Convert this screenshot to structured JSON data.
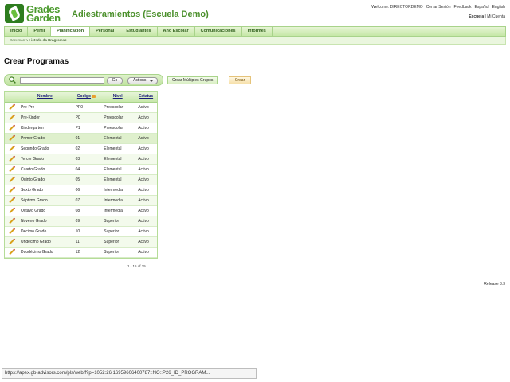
{
  "header": {
    "logo_line1": "Grades",
    "logo_line2": "Garden",
    "app_title": "Adiestramientos (Escuela Demo)",
    "top_links": [
      "Welcome: DIRECTORDEMO",
      "Cerrar Sesión",
      "Feedback",
      "Español",
      "English"
    ],
    "scope_active": "Escuela",
    "scope_sep": " | ",
    "scope_other": "Mi Cuenta"
  },
  "nav": {
    "tabs": [
      "Inicio",
      "Perfil",
      "Planificación",
      "Personal",
      "Estudiantes",
      "Año Escolar",
      "Comunicaciones",
      "Informes"
    ],
    "active_index": 2
  },
  "breadcrumb": {
    "parent": "Resumen",
    "sep": " > ",
    "current": "Listado de Programas"
  },
  "page_title": "Crear Programas",
  "search": {
    "value": "",
    "go_label": "Go",
    "actions_label": "Actions"
  },
  "buttons": {
    "create_multiple": "Crear Múltiples Grupos",
    "create": "Crear"
  },
  "table": {
    "columns": [
      "Nombre",
      "Codigo",
      "Nivel",
      "Estatus"
    ],
    "rows": [
      [
        "Pre-Pre",
        "PP0",
        "Preescolar",
        "Activo"
      ],
      [
        "Pre-Kinder",
        "P0",
        "Preescolar",
        "Activo"
      ],
      [
        "Kindergarten",
        "P1",
        "Preescolar",
        "Activo"
      ],
      [
        "Primer Grado",
        "01",
        "Elemental",
        "Activo"
      ],
      [
        "Segundo Grado",
        "02",
        "Elemental",
        "Activo"
      ],
      [
        "Tercer Grado",
        "03",
        "Elemental",
        "Activo"
      ],
      [
        "Cuarto Grado",
        "04",
        "Elemental",
        "Activo"
      ],
      [
        "Quinto Grado",
        "05",
        "Elemental",
        "Activo"
      ],
      [
        "Sexto Grado",
        "06",
        "Intermedia",
        "Activo"
      ],
      [
        "Séptimo Grado",
        "07",
        "Intermedia",
        "Activo"
      ],
      [
        "Octavo Grado",
        "08",
        "Intermedia",
        "Activo"
      ],
      [
        "Noveno Grado",
        "09",
        "Superior",
        "Activo"
      ],
      [
        "Decimo Grado",
        "10",
        "Superior",
        "Activo"
      ],
      [
        "Undécimo Grado",
        "11",
        "Superior",
        "Activo"
      ],
      [
        "Duodécimo Grado",
        "12",
        "Superior",
        "Activo"
      ]
    ],
    "pagination": "1 - 15 of 15"
  },
  "footer": {
    "release": "Release 3.3"
  },
  "statusbar": {
    "url": "https://apex.gb-advisors.com/pls/web/f?p=1052:26:16959606400787::NO::P26_ID_PROGRAM..."
  }
}
